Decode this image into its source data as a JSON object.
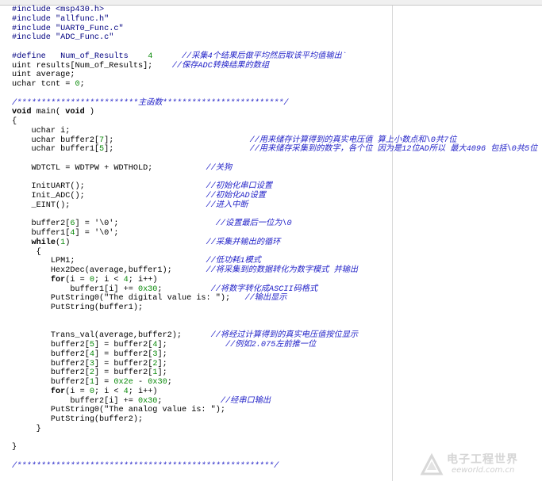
{
  "editor": {
    "lines": [
      [
        {
          "t": "#include <msp430.h>",
          "c": "pp"
        }
      ],
      [
        {
          "t": "#include \"allfunc.h\"",
          "c": "pp"
        }
      ],
      [
        {
          "t": "#include \"UART0_Func.c\"",
          "c": "pp"
        }
      ],
      [
        {
          "t": "#include \"ADC_Func.c\"",
          "c": "pp"
        }
      ],
      [],
      [
        {
          "t": "#define   Num_of_Results    ",
          "c": "pp"
        },
        {
          "t": "4",
          "c": "num"
        },
        {
          "t": "      ",
          "c": ""
        },
        {
          "t": "//采集4个结果后做平均然后取该平均值输出`",
          "c": "cm"
        }
      ],
      [
        {
          "t": "uint results[Num_of_Results];    ",
          "c": ""
        },
        {
          "t": "//保存ADC转换结果的数组",
          "c": "cm"
        }
      ],
      [
        {
          "t": "uint average;",
          "c": ""
        }
      ],
      [
        {
          "t": "uchar tcnt = ",
          "c": ""
        },
        {
          "t": "0",
          "c": "num"
        },
        {
          "t": ";",
          "c": ""
        }
      ],
      [],
      [
        {
          "t": "/*************************主函数*************************/",
          "c": "cm"
        }
      ],
      [
        {
          "t": "void",
          "c": "kw"
        },
        {
          "t": " main( ",
          "c": ""
        },
        {
          "t": "void",
          "c": "kw"
        },
        {
          "t": " )",
          "c": ""
        }
      ],
      [
        {
          "t": "{",
          "c": ""
        }
      ],
      [
        {
          "t": "    uchar i;",
          "c": ""
        }
      ],
      [
        {
          "t": "    uchar buffer2[",
          "c": ""
        },
        {
          "t": "7",
          "c": "num"
        },
        {
          "t": "];                            ",
          "c": ""
        },
        {
          "t": "//用来储存计算得到的真实电压值 算上小数点和\\0共7位",
          "c": "cm"
        }
      ],
      [
        {
          "t": "    uchar buffer1[",
          "c": ""
        },
        {
          "t": "5",
          "c": "num"
        },
        {
          "t": "];                            ",
          "c": ""
        },
        {
          "t": "//用来储存采集到的数字，各个位 因为是12位AD所以 最大4096 包括\\0共5位",
          "c": "cm"
        }
      ],
      [],
      [
        {
          "t": "    WDTCTL = WDTPW + WDTHOLD;           ",
          "c": ""
        },
        {
          "t": "//关狗",
          "c": "cm"
        }
      ],
      [],
      [
        {
          "t": "    InitUART();                         ",
          "c": ""
        },
        {
          "t": "//初始化串口设置",
          "c": "cm"
        }
      ],
      [
        {
          "t": "    Init_ADC();                         ",
          "c": ""
        },
        {
          "t": "//初始化AD设置",
          "c": "cm"
        }
      ],
      [
        {
          "t": "    _EINT();                            ",
          "c": ""
        },
        {
          "t": "//进入中断",
          "c": "cm"
        }
      ],
      [],
      [
        {
          "t": "    buffer2[",
          "c": ""
        },
        {
          "t": "6",
          "c": "num"
        },
        {
          "t": "] = '\\0';                    ",
          "c": ""
        },
        {
          "t": "//设置最后一位为\\0",
          "c": "cm"
        }
      ],
      [
        {
          "t": "    buffer1[",
          "c": ""
        },
        {
          "t": "4",
          "c": "num"
        },
        {
          "t": "] = '\\0';",
          "c": ""
        }
      ],
      [
        {
          "t": "    ",
          "c": ""
        },
        {
          "t": "while",
          "c": "kw"
        },
        {
          "t": "(",
          "c": ""
        },
        {
          "t": "1",
          "c": "num"
        },
        {
          "t": ")                            ",
          "c": ""
        },
        {
          "t": "//采集并输出的循环",
          "c": "cm"
        }
      ],
      [
        {
          "t": "     {",
          "c": ""
        }
      ],
      [
        {
          "t": "        LPM1;                           ",
          "c": ""
        },
        {
          "t": "//低功耗1模式",
          "c": "cm"
        }
      ],
      [
        {
          "t": "        Hex2Dec(average,buffer1);       ",
          "c": ""
        },
        {
          "t": "//将采集到的数据转化为数字模式 并输出",
          "c": "cm"
        }
      ],
      [
        {
          "t": "        ",
          "c": ""
        },
        {
          "t": "for",
          "c": "kw"
        },
        {
          "t": "(i = ",
          "c": ""
        },
        {
          "t": "0",
          "c": "num"
        },
        {
          "t": "; i < ",
          "c": ""
        },
        {
          "t": "4",
          "c": "num"
        },
        {
          "t": "; i++)",
          "c": ""
        }
      ],
      [
        {
          "t": "            buffer1[i] += ",
          "c": ""
        },
        {
          "t": "0x30",
          "c": "num"
        },
        {
          "t": ";          ",
          "c": ""
        },
        {
          "t": "//将数字转化成ASCII码格式",
          "c": "cm"
        }
      ],
      [
        {
          "t": "        PutString0(\"The digital value is: \");   ",
          "c": ""
        },
        {
          "t": "//输出显示",
          "c": "cm"
        }
      ],
      [
        {
          "t": "        PutString(buffer1);",
          "c": ""
        }
      ],
      [],
      [],
      [
        {
          "t": "        Trans_val(average,buffer2);      ",
          "c": ""
        },
        {
          "t": "//将经过计算得到的真实电压值按位显示",
          "c": "cm"
        }
      ],
      [
        {
          "t": "        buffer2[",
          "c": ""
        },
        {
          "t": "5",
          "c": "num"
        },
        {
          "t": "] = buffer2[",
          "c": ""
        },
        {
          "t": "4",
          "c": "num"
        },
        {
          "t": "];            ",
          "c": ""
        },
        {
          "t": "//例如2.075左前推一位",
          "c": "cm"
        }
      ],
      [
        {
          "t": "        buffer2[",
          "c": ""
        },
        {
          "t": "4",
          "c": "num"
        },
        {
          "t": "] = buffer2[",
          "c": ""
        },
        {
          "t": "3",
          "c": "num"
        },
        {
          "t": "];",
          "c": ""
        }
      ],
      [
        {
          "t": "        buffer2[",
          "c": ""
        },
        {
          "t": "3",
          "c": "num"
        },
        {
          "t": "] = buffer2[",
          "c": ""
        },
        {
          "t": "2",
          "c": "num"
        },
        {
          "t": "];",
          "c": ""
        }
      ],
      [
        {
          "t": "        buffer2[",
          "c": ""
        },
        {
          "t": "2",
          "c": "num"
        },
        {
          "t": "] = buffer2[",
          "c": ""
        },
        {
          "t": "1",
          "c": "num"
        },
        {
          "t": "];",
          "c": ""
        }
      ],
      [
        {
          "t": "        buffer2[",
          "c": ""
        },
        {
          "t": "1",
          "c": "num"
        },
        {
          "t": "] = ",
          "c": ""
        },
        {
          "t": "0x2e",
          "c": "num"
        },
        {
          "t": " - ",
          "c": ""
        },
        {
          "t": "0x30",
          "c": "num"
        },
        {
          "t": ";",
          "c": ""
        }
      ],
      [
        {
          "t": "        ",
          "c": ""
        },
        {
          "t": "for",
          "c": "kw"
        },
        {
          "t": "(i = ",
          "c": ""
        },
        {
          "t": "0",
          "c": "num"
        },
        {
          "t": "; i < ",
          "c": ""
        },
        {
          "t": "4",
          "c": "num"
        },
        {
          "t": "; i++)",
          "c": ""
        }
      ],
      [
        {
          "t": "            buffer2[i] += ",
          "c": ""
        },
        {
          "t": "0x30",
          "c": "num"
        },
        {
          "t": ";            ",
          "c": ""
        },
        {
          "t": "//经串口输出",
          "c": "cm"
        }
      ],
      [
        {
          "t": "        PutString0(\"The analog value is: \");",
          "c": ""
        }
      ],
      [
        {
          "t": "        PutString(buffer2);",
          "c": ""
        }
      ],
      [
        {
          "t": "     }",
          "c": ""
        }
      ],
      [],
      [
        {
          "t": "}",
          "c": ""
        }
      ],
      [],
      [
        {
          "t": "/*****************************************************/",
          "c": "cm"
        }
      ]
    ]
  },
  "watermark": {
    "cn": "电子工程世界",
    "en": "eeworld.com.cn"
  },
  "colors": {
    "comment": "#2323c8",
    "number": "#0a8a0a",
    "preprocessor": "#000080"
  }
}
